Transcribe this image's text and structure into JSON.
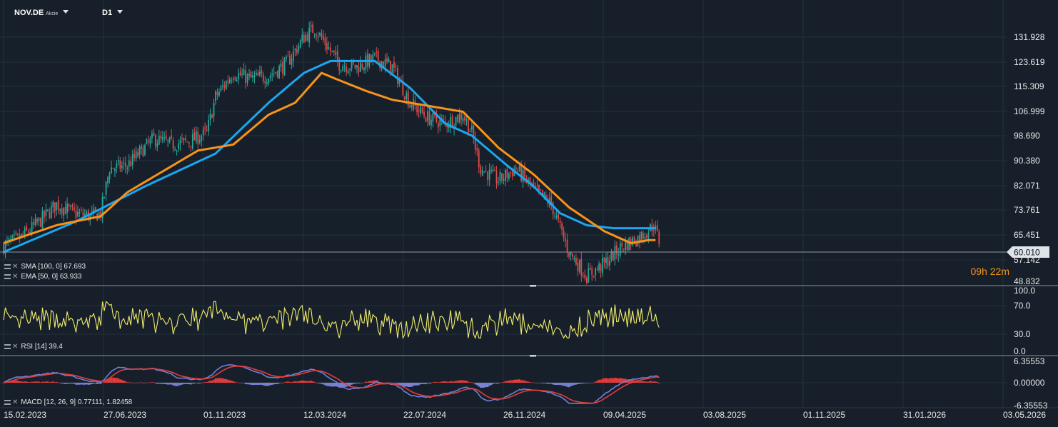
{
  "header": {
    "symbol": "NOV.DE",
    "instrument_type": "Akcie",
    "timeframe": "D1"
  },
  "countdown": "09h 22m",
  "indicators": {
    "sma": "SMA [100, 0] 67.693",
    "ema": "EMA [50, 0] 63.933",
    "rsi": "RSI [14] 39.4",
    "macd": "MACD [12, 26, 9] 0.77111,  1.82458"
  },
  "colors": {
    "background": "#17202a",
    "grid": "#26303a",
    "sma": "#1aa6f0",
    "ema": "#f7931a",
    "candle_up": "#26a69a",
    "candle_down": "#e04848",
    "rsi": "#f0ec6c",
    "macd_line": "#6f7fd8",
    "signal_line": "#e23c3c",
    "hist_pos": "#e23c3c",
    "hist_neg": "#7a82d6"
  },
  "chart_data": [
    {
      "type": "candlestick",
      "title": "NOV.DE",
      "y_ticks": [
        "131.928",
        "123.619",
        "115.309",
        "106.999",
        "98.690",
        "90.380",
        "82.071",
        "73.761",
        "65.451",
        "57.142",
        "48.832"
      ],
      "ylim": [
        48.832,
        140.2
      ],
      "last_price": "60.010",
      "x_ticks": [
        "15.02.2023",
        "27.06.2023",
        "01.11.2023",
        "12.03.2024",
        "22.07.2024",
        "26.11.2024",
        "09.04.2025",
        "03.08.2025",
        "01.11.2025",
        "31.01.2026",
        "03.05.2026"
      ],
      "price_anchors": [
        [
          0,
          62
        ],
        [
          10,
          65
        ],
        [
          20,
          70
        ],
        [
          30,
          76
        ],
        [
          40,
          73
        ],
        [
          50,
          72
        ],
        [
          55,
          73
        ],
        [
          60,
          88
        ],
        [
          70,
          89
        ],
        [
          85,
          98
        ],
        [
          95,
          96
        ],
        [
          105,
          97
        ],
        [
          115,
          100
        ],
        [
          120,
          112
        ],
        [
          130,
          120
        ],
        [
          140,
          118
        ],
        [
          150,
          119
        ],
        [
          160,
          123
        ],
        [
          170,
          132
        ],
        [
          176,
          135
        ],
        [
          182,
          130
        ],
        [
          190,
          123
        ],
        [
          200,
          122
        ],
        [
          210,
          125
        ],
        [
          220,
          122
        ],
        [
          230,
          110
        ],
        [
          240,
          105
        ],
        [
          250,
          103
        ],
        [
          260,
          106
        ],
        [
          265,
          100
        ],
        [
          270,
          88
        ],
        [
          280,
          84
        ],
        [
          290,
          88
        ],
        [
          300,
          81
        ],
        [
          310,
          76
        ],
        [
          320,
          60
        ],
        [
          330,
          52
        ],
        [
          340,
          56
        ],
        [
          350,
          62
        ],
        [
          360,
          65
        ],
        [
          368,
          69
        ],
        [
          372,
          62
        ]
      ],
      "series": [
        {
          "name": "SMA [100, 0]",
          "anchors": [
            [
              0,
              60
            ],
            [
              40,
              70
            ],
            [
              80,
              82
            ],
            [
              120,
              93
            ],
            [
              150,
              110
            ],
            [
              170,
              120
            ],
            [
              185,
              124
            ],
            [
              210,
              124
            ],
            [
              230,
              115
            ],
            [
              250,
              103
            ],
            [
              265,
              99
            ],
            [
              285,
              89
            ],
            [
              300,
              82
            ],
            [
              315,
              73
            ],
            [
              330,
              69
            ],
            [
              345,
              68
            ],
            [
              360,
              68
            ]
          ]
        },
        {
          "name": "EMA [50, 0]",
          "anchors": [
            [
              0,
              63
            ],
            [
              30,
              69
            ],
            [
              55,
              72
            ],
            [
              70,
              80
            ],
            [
              90,
              87
            ],
            [
              110,
              94
            ],
            [
              130,
              96
            ],
            [
              150,
              106
            ],
            [
              165,
              110
            ],
            [
              180,
              120
            ],
            [
              188,
              118
            ],
            [
              205,
              114
            ],
            [
              220,
              111
            ],
            [
              240,
              109
            ],
            [
              260,
              107
            ],
            [
              280,
              95
            ],
            [
              300,
              86
            ],
            [
              320,
              75
            ],
            [
              340,
              67
            ],
            [
              355,
              63
            ],
            [
              365,
              64
            ],
            [
              368,
              64
            ]
          ]
        }
      ]
    },
    {
      "type": "line",
      "title": "RSI [14]",
      "y_ticks": [
        "100.0",
        "70.0",
        "30.0",
        "0.0"
      ],
      "ylim": [
        0,
        100
      ],
      "last_value": 39.4
    },
    {
      "type": "bar",
      "title": "MACD [12, 26, 9]",
      "y_ticks": [
        "6.35553",
        "0.00000",
        "-6.35553"
      ],
      "ylim": [
        -6.35553,
        6.35553
      ],
      "macd": 0.77111,
      "signal": 1.82458
    }
  ]
}
